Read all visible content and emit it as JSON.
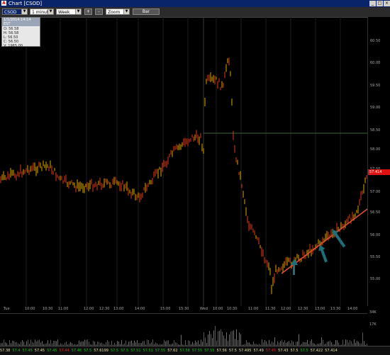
{
  "window": {
    "title": "Chart [CSOD]",
    "app_icon_letter": "A",
    "buttons": [
      "_",
      "□",
      "×"
    ]
  },
  "toolbar": {
    "symbol": "CSOD",
    "interval": "1 minute",
    "range": "Week",
    "zoom_in_label": "+",
    "zoom_out_label": "-",
    "zoom": "Zoom",
    "chart_type_label": "Bar"
  },
  "ohlc": {
    "header": "1/1/2014 14:14 EST",
    "open": "O: 56.58",
    "high": "H: 56.58",
    "low": "L: 56.50",
    "close": "C: 56.50",
    "volume": "V: 1965.00"
  },
  "price_axis": {
    "ticks": [
      "60.50",
      "60.00",
      "59.50",
      "59.00",
      "58.50",
      "58.00",
      "57.50",
      "57.00",
      "56.50",
      "56.00",
      "55.50",
      "55.00"
    ],
    "last_price_tag": "57.414"
  },
  "time_axis": {
    "ticks": [
      "Tue",
      "10:00",
      "10:30",
      "11:00",
      "12:00",
      "12:30",
      "13:00",
      "14:00",
      "15:00",
      "15:30",
      "Wed",
      "10:00",
      "10:30",
      "11:00",
      "11:30",
      "12:00",
      "12:30",
      "13:00",
      "13:30",
      "14:00"
    ]
  },
  "volume_axis": {
    "ticks": [
      "34K",
      "17K"
    ]
  },
  "tape": [
    {
      "v": "57.38",
      "c": "un"
    },
    {
      "v": "57.4",
      "c": "up"
    },
    {
      "v": "57.45",
      "c": "up"
    },
    {
      "v": "57.45",
      "c": "un"
    },
    {
      "v": "57.45",
      "c": "up"
    },
    {
      "v": "57.44",
      "c": "dn"
    },
    {
      "v": "57.46",
      "c": "up"
    },
    {
      "v": "57.5",
      "c": "up"
    },
    {
      "v": "57.6199",
      "c": "un"
    },
    {
      "v": "57.5",
      "c": "up"
    },
    {
      "v": "57.5",
      "c": "up"
    },
    {
      "v": "57.51",
      "c": "up"
    },
    {
      "v": "57.51",
      "c": "up"
    },
    {
      "v": "57.55",
      "c": "up"
    },
    {
      "v": "57.62",
      "c": "un"
    },
    {
      "v": "57.58",
      "c": "up"
    },
    {
      "v": "57.55",
      "c": "up"
    },
    {
      "v": "57.55",
      "c": "up"
    },
    {
      "v": "57.56",
      "c": "un"
    },
    {
      "v": "57.5",
      "c": "un"
    },
    {
      "v": "57.495",
      "c": "un"
    },
    {
      "v": "57.49",
      "c": "un"
    },
    {
      "v": "57.45",
      "c": "dn"
    },
    {
      "v": "57.43",
      "c": "un"
    },
    {
      "v": "57.5",
      "c": "un"
    },
    {
      "v": "57.5",
      "c": "up"
    },
    {
      "v": "57.422",
      "c": "un"
    },
    {
      "v": "57.414",
      "c": "un"
    }
  ],
  "colors": {
    "background": "#000000",
    "bar": "#e0a800",
    "bar_down": "#e03a1a",
    "trendline": "#e05030",
    "arrow": "#1f6e78",
    "resistance": "#3a6a3a"
  }
}
